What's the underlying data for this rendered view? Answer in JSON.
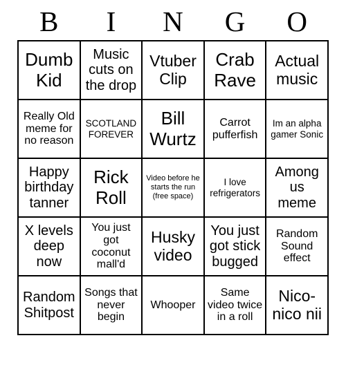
{
  "header": {
    "letters": [
      "B",
      "I",
      "N",
      "G",
      "O"
    ]
  },
  "grid": {
    "rows": [
      [
        {
          "text": "Dumb Kid",
          "size": "fs-xxl"
        },
        {
          "text": "Music cuts on the drop",
          "size": "fs-lg"
        },
        {
          "text": "Vtuber Clip",
          "size": "fs-xl"
        },
        {
          "text": "Crab Rave",
          "size": "fs-xxl"
        },
        {
          "text": "Actual music",
          "size": "fs-xl"
        }
      ],
      [
        {
          "text": "Really Old meme for no reason",
          "size": "fs-md"
        },
        {
          "text": "SCOTLAND FOREVER",
          "size": "fs-sm"
        },
        {
          "text": "Bill Wurtz",
          "size": "fs-xxl"
        },
        {
          "text": "Carrot pufferfish",
          "size": "fs-md"
        },
        {
          "text": "Im an alpha gamer Sonic",
          "size": "fs-sm"
        }
      ],
      [
        {
          "text": "Happy birthday tanner",
          "size": "fs-lg"
        },
        {
          "text": "Rick Roll",
          "size": "fs-xxl"
        },
        {
          "text": "Video before he starts the run (free space)",
          "size": "fs-xs"
        },
        {
          "text": "I love refrigerators",
          "size": "fs-sm"
        },
        {
          "text": "Among us meme",
          "size": "fs-lg"
        }
      ],
      [
        {
          "text": "X levels deep now",
          "size": "fs-lg"
        },
        {
          "text": "You just got coconut mall'd",
          "size": "fs-md"
        },
        {
          "text": "Husky video",
          "size": "fs-xl"
        },
        {
          "text": "You just got stick bugged",
          "size": "fs-lg"
        },
        {
          "text": "Random Sound effect",
          "size": "fs-md"
        }
      ],
      [
        {
          "text": "Random Shitpost",
          "size": "fs-lg"
        },
        {
          "text": "Songs that never begin",
          "size": "fs-md"
        },
        {
          "text": "Whooper",
          "size": "fs-md"
        },
        {
          "text": "Same video twice in a roll",
          "size": "fs-md"
        },
        {
          "text": "Nico-nico nii",
          "size": "fs-xl"
        }
      ]
    ]
  }
}
